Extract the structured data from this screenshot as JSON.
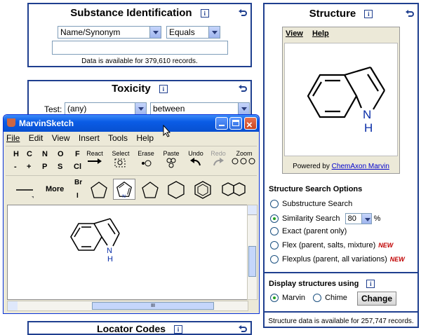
{
  "substance": {
    "title": "Substance Identification",
    "search_type": "Name/Synonym",
    "operator": "Equals",
    "search_value": "",
    "availability": "Data is available for 379,610 records."
  },
  "toxicity": {
    "title": "Toxicity",
    "test_label": "Test:",
    "test_value": "(any)",
    "range_value": "between"
  },
  "locator": {
    "title": "Locator Codes"
  },
  "marvin": {
    "title": "MarvinSketch",
    "menu": [
      "File",
      "Edit",
      "View",
      "Insert",
      "Tools",
      "Help"
    ],
    "elements_row1": [
      "H",
      "C",
      "N",
      "O",
      "F"
    ],
    "elements_row2": [
      "-",
      "+",
      "P",
      "S",
      "Cl"
    ],
    "br": "Br",
    "i": "I",
    "more": "More",
    "tools": [
      "React",
      "Select",
      "Erase",
      "Paste",
      "Undo",
      "Redo",
      "Zoom"
    ],
    "atom_h": "H",
    "scroll_grip": "III"
  },
  "structure": {
    "title": "Structure",
    "viewer_menu": [
      "View",
      "Help"
    ],
    "atom_label_n": "N",
    "atom_label_h": "H",
    "powered_prefix": "Powered by",
    "powered_link": "ChemAxon Marvin",
    "search_options_title": "Structure Search Options",
    "options": [
      {
        "label": "Substructure Search",
        "selected": false
      },
      {
        "label": "Similarity Search",
        "selected": true
      },
      {
        "label": "Exact (parent only)",
        "selected": false
      },
      {
        "label": "Flex (parent, salts, mixture)",
        "selected": false,
        "new": "NEW"
      },
      {
        "label": "Flexplus (parent, all variations)",
        "selected": false,
        "new": "NEW"
      }
    ],
    "similarity_value": "80",
    "similarity_unit": "%",
    "display_title": "Display structures using",
    "display_options": [
      {
        "label": "Marvin",
        "selected": true
      },
      {
        "label": "Chime",
        "selected": false
      }
    ],
    "change_button": "Change",
    "availability": "Structure data is available for 257,747 records."
  },
  "colors": {
    "panel_border": "#1f3f8f",
    "new_tag": "#c00000",
    "window_title": "#0a5ce6"
  }
}
